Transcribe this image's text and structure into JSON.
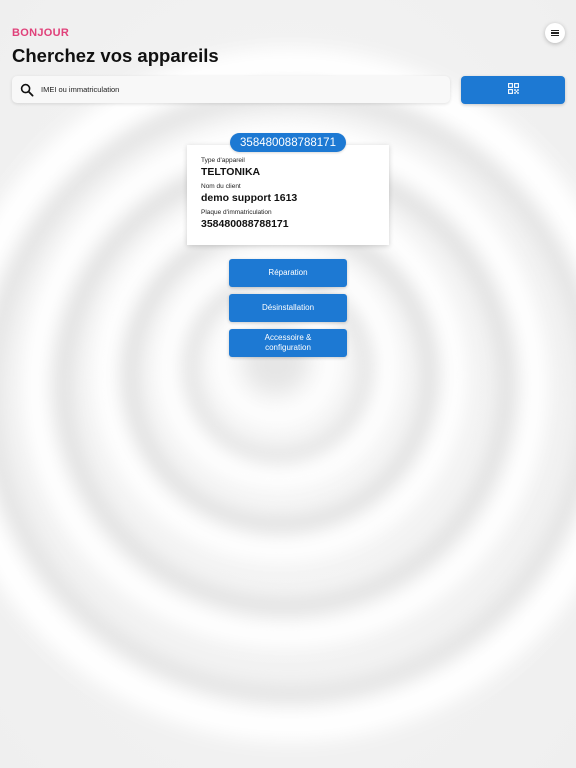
{
  "header": {
    "greeting": "BONJOUR",
    "title": "Cherchez vos appareils",
    "menu_icon": "hamburger-menu-icon"
  },
  "search": {
    "placeholder": "IMEI ou immatriculation",
    "value": "",
    "search_icon": "search-icon",
    "scan_icon": "qr-code-icon"
  },
  "device": {
    "imei_badge": "358480088788171",
    "type_label": "Type d'appareil",
    "type_value": "TELTONIKA",
    "client_label": "Nom du client",
    "client_value": "demo support 1613",
    "plate_label": "Plaque d'immatriculation",
    "plate_value": "358480088788171"
  },
  "actions": {
    "repair": "Réparation",
    "uninstall": "Désinstallation",
    "accessory": "Accessoire & configuration"
  },
  "colors": {
    "accent": "#1d79d3",
    "greeting": "#e0417a",
    "background": "#f4f4f4"
  }
}
